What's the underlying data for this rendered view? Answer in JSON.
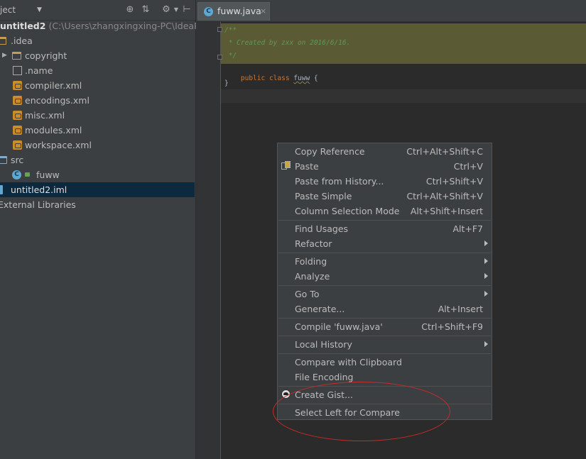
{
  "project_panel": {
    "view_combo": "ject",
    "tree": [
      {
        "label": "untitled2",
        "path": "(C:\\Users\\zhangxingxing-PC\\IdeaProje",
        "kind": "project"
      },
      {
        "label": ".idea",
        "kind": "folder-orange"
      },
      {
        "label": "copyright",
        "kind": "folder-orange"
      },
      {
        "label": ".name",
        "kind": "file"
      },
      {
        "label": "compiler.xml",
        "kind": "xml"
      },
      {
        "label": "encodings.xml",
        "kind": "xml"
      },
      {
        "label": "misc.xml",
        "kind": "xml"
      },
      {
        "label": "modules.xml",
        "kind": "xml"
      },
      {
        "label": "workspace.xml",
        "kind": "xml"
      },
      {
        "label": "src",
        "kind": "folder-blue"
      },
      {
        "label": "fuww",
        "kind": "class"
      },
      {
        "label": "untitled2.iml",
        "kind": "iml",
        "selected": true
      },
      {
        "label": "External Libraries",
        "kind": "libraries"
      }
    ],
    "toolbar_icons": [
      "target-icon",
      "collapse-icon",
      "gear-icon",
      "hide-icon"
    ]
  },
  "editor": {
    "tab": {
      "label": "fuww.java",
      "close": "×",
      "icon": "class-icon"
    },
    "code": {
      "doc_open": "/**",
      "doc_body": " * Created by zxx on 2016/6/16.",
      "doc_close": " */",
      "kw1": "public",
      "kw2": "class",
      "class_name": "fuww",
      "brace_open": "{",
      "brace_close": "}"
    }
  },
  "context_menu": {
    "groups": [
      [
        {
          "label": "Copy Reference",
          "shortcut": "Ctrl+Alt+Shift+C"
        },
        {
          "label": "Paste",
          "shortcut": "Ctrl+V",
          "icon": "paste-icon"
        },
        {
          "label": "Paste from History...",
          "shortcut": "Ctrl+Shift+V"
        },
        {
          "label": "Paste Simple",
          "shortcut": "Ctrl+Alt+Shift+V"
        },
        {
          "label": "Column Selection Mode",
          "shortcut": "Alt+Shift+Insert"
        }
      ],
      [
        {
          "label": "Find Usages",
          "shortcut": "Alt+F7"
        },
        {
          "label": "Refactor",
          "submenu": true
        }
      ],
      [
        {
          "label": "Folding",
          "submenu": true
        },
        {
          "label": "Analyze",
          "submenu": true
        }
      ],
      [
        {
          "label": "Go To",
          "submenu": true
        },
        {
          "label": "Generate...",
          "shortcut": "Alt+Insert"
        }
      ],
      [
        {
          "label": "Compile 'fuww.java'",
          "shortcut": "Ctrl+Shift+F9"
        }
      ],
      [
        {
          "label": "Local History",
          "submenu": true
        }
      ],
      [
        {
          "label": "Compare with Clipboard"
        },
        {
          "label": "File Encoding"
        }
      ],
      [
        {
          "label": "Create Gist...",
          "icon": "github-icon"
        }
      ],
      [
        {
          "label": "Select Left for Compare"
        }
      ]
    ]
  },
  "colors": {
    "accent_selection": "#0d293e",
    "annotation_ellipse": "#c42c2c",
    "doc_comment": "#629755",
    "keyword": "#cc7832"
  }
}
